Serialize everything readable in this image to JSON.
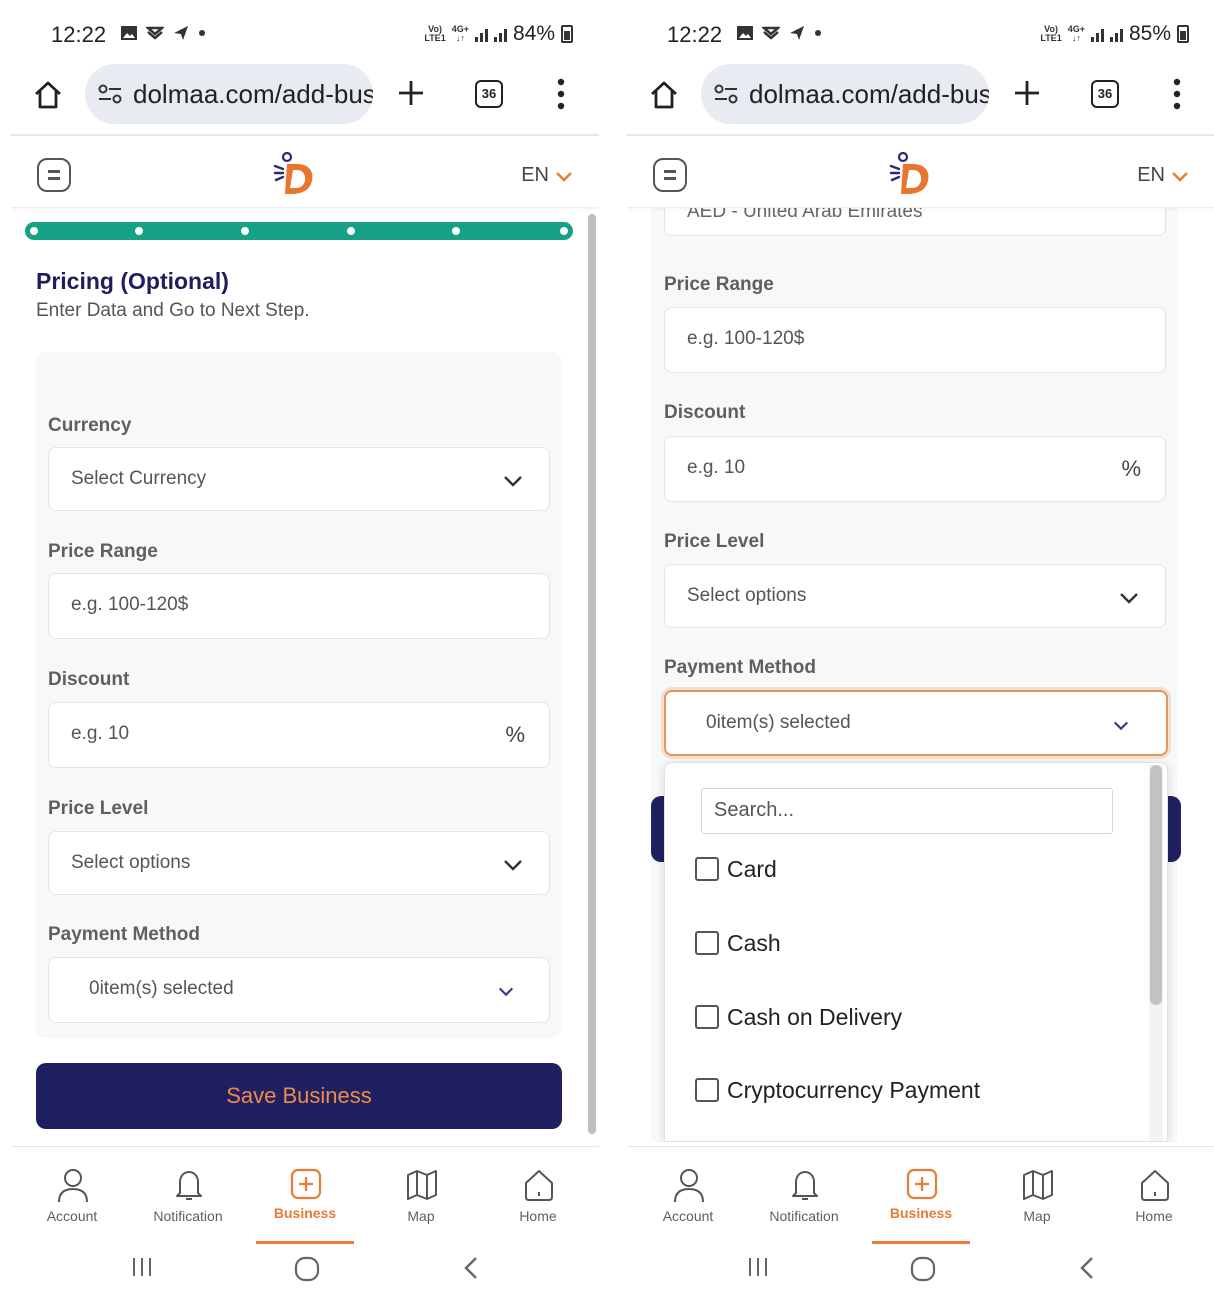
{
  "left": {
    "status": {
      "time": "12:22",
      "battery": "84%",
      "network": "Vo) 4G+\nLTE1"
    },
    "browser": {
      "url": "dolmaa.com/add-bus",
      "tab_count": "36"
    },
    "header": {
      "language": "EN"
    },
    "progress": {
      "steps": 6,
      "current_step": 6
    },
    "step": {
      "title": "Pricing (Optional)",
      "subtitle": "Enter Data and Go to Next Step."
    },
    "form": {
      "currency_label": "Currency",
      "currency_value": "Select Currency",
      "price_range_label": "Price Range",
      "price_range_placeholder": "e.g. 100-120$",
      "discount_label": "Discount",
      "discount_placeholder": "e.g. 10",
      "discount_unit": "%",
      "price_level_label": "Price Level",
      "price_level_value": "Select options",
      "payment_label": "Payment Method",
      "payment_value": "0item(s) selected"
    },
    "save_label": "Save Business"
  },
  "right": {
    "status": {
      "time": "12:22",
      "battery": "85%"
    },
    "browser": {
      "url": "dolmaa.com/add-bus",
      "tab_count": "36"
    },
    "header": {
      "language": "EN"
    },
    "form": {
      "currency_value_partial": "AED - United Arab Emirates",
      "price_range_label": "Price Range",
      "price_range_placeholder": "e.g. 100-120$",
      "discount_label": "Discount",
      "discount_placeholder": "e.g. 10",
      "discount_unit": "%",
      "price_level_label": "Price Level",
      "price_level_value": "Select options",
      "payment_label": "Payment Method",
      "payment_value": "0item(s) selected"
    },
    "dropdown": {
      "search_placeholder": "Search...",
      "options": [
        "Card",
        "Cash",
        "Cash on Delivery",
        "Cryptocurrency Payment"
      ]
    }
  },
  "nav": {
    "items": [
      "Account",
      "Notification",
      "Business",
      "Map",
      "Home"
    ],
    "active": "Business"
  },
  "colors": {
    "accent": "#ea7a35",
    "primary": "#1f2060",
    "progress": "#16a085",
    "title": "#1f1d5e"
  }
}
